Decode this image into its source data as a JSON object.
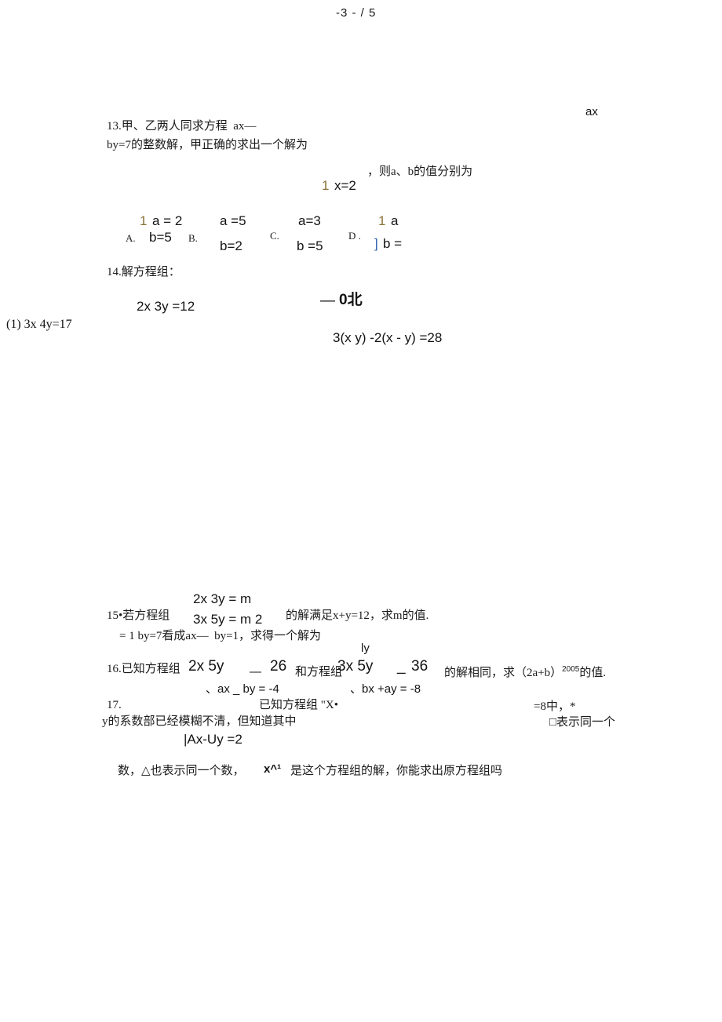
{
  "document": {
    "page_label": "-3 - / 5"
  },
  "q13": {
    "number": "13.",
    "line1": "甲、乙两人同求方程  ax—",
    "line2": "by=7的整数解，甲正确的求出一个解为",
    "stray_ax": "ax",
    "solution_brace": "1",
    "solution_x": "x=2",
    "tail": "，则a、b的值分别为",
    "options": [
      {
        "letter": "A.",
        "brace": "1",
        "top": "a = 2",
        "bottom": "b=5"
      },
      {
        "letter": "B.",
        "brace": "",
        "top": "a =5",
        "bottom": "b=2"
      },
      {
        "letter": "C.",
        "brace": "",
        "top": "a=3",
        "bottom": "b =5"
      },
      {
        "letter": "D .",
        "brace": "1",
        "brace_bottom": "]",
        "top": "a",
        "bottom": "b ="
      }
    ]
  },
  "q14": {
    "number": "14.",
    "prompt": "解方程组：",
    "eq_left_top": "2x 3y =12",
    "eq_left_label": "(1) 3x 4y=17",
    "eq_right_top_dash": "—",
    "eq_right_top_value": "0北",
    "eq_right_bottom": "3(x y) -2(x - y) =28"
  },
  "q15": {
    "number": "15•",
    "prompt": "若方程组",
    "eq_top": "2x 3y = m",
    "eq_bottom": "3x 5y = m 2",
    "tail": "的解满足x+y=12，求m的值.",
    "stray_line": "= 1 by=7看成ax—  by=1，求得一个解为"
  },
  "q16": {
    "number": "16.",
    "prompt": "已知方程组",
    "sys1_top": "2x 5y",
    "sys1_dash": "—",
    "sys1_value": "26",
    "sys1_bottom": "、ax _ by = -4",
    "middle": "和方程组",
    "stray_ly": "ly",
    "sys2_top": "3x 5y",
    "sys2_underscore": "_",
    "sys2_value": "36",
    "sys2_bottom": "、bx +ay = -8",
    "tail": "的解相同，求（2a+b）",
    "tail_sup": "2005",
    "tail_end": "的值."
  },
  "q17": {
    "number": "17.",
    "line1_mid": "已知方程组 \"X•",
    "line1_right": "=8中，*",
    "line2": "y的系数部已经模糊不清，但知道其中",
    "line2_right": "□表示同一个",
    "eq": "|Ax-Uy =2",
    "line3_a": "数，△也表示同一个数，",
    "line3_b": "x^¹",
    "line3_c": "是这个方程组的解，你能求出原方程组吗"
  }
}
